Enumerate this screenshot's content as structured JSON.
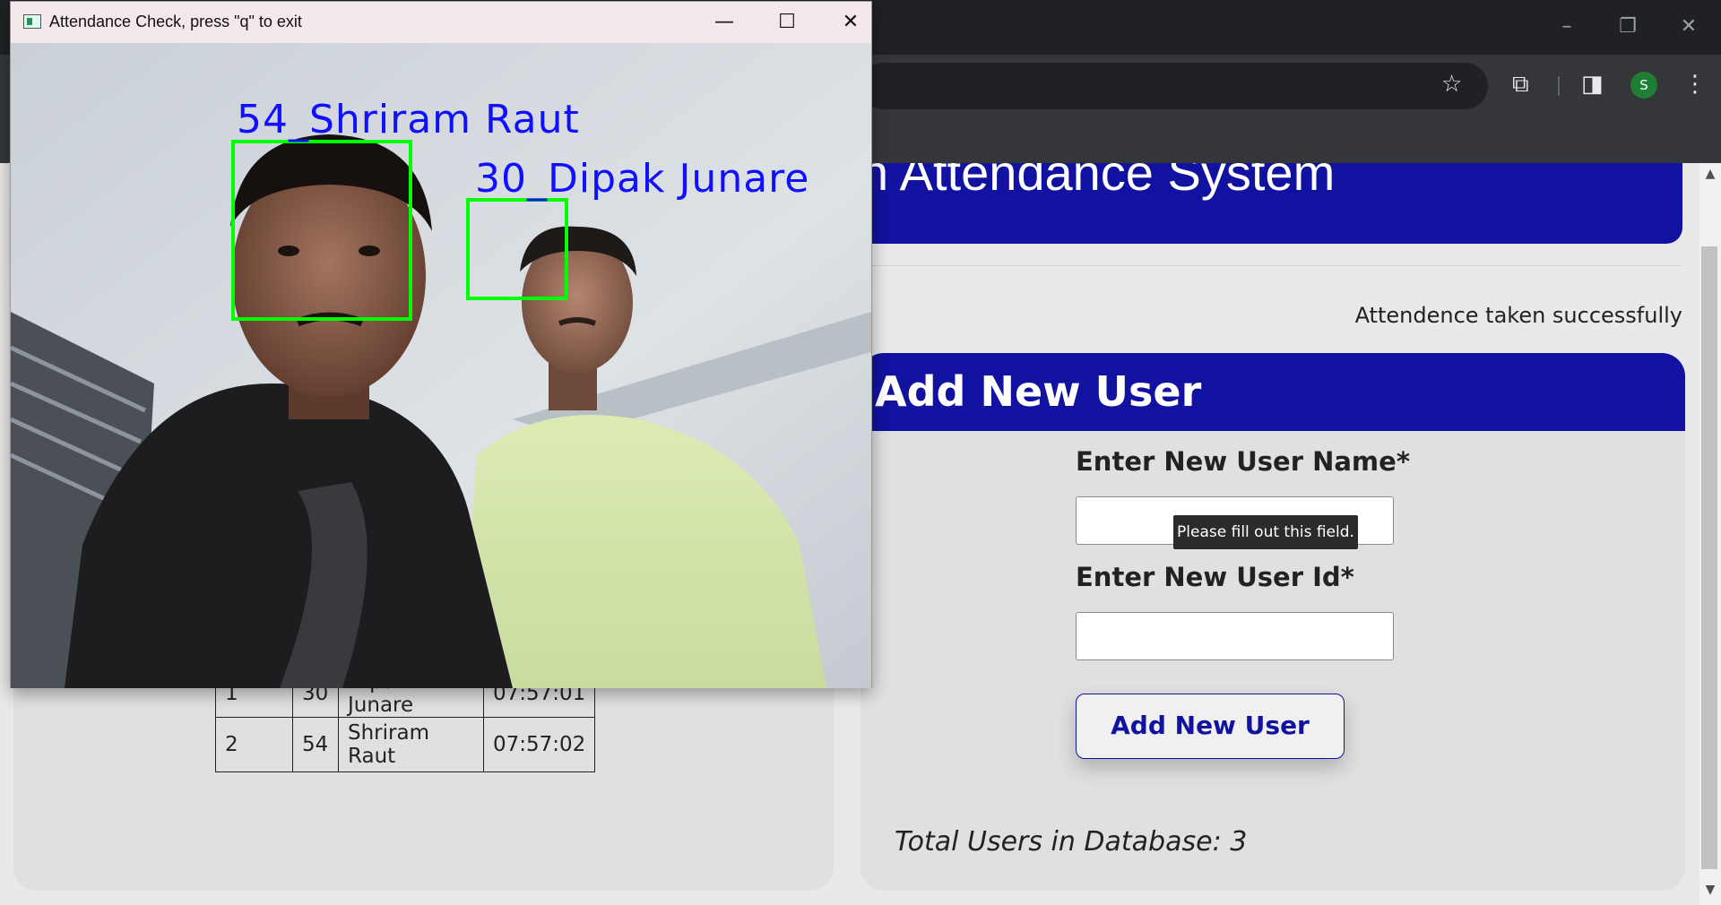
{
  "browser": {
    "minimize_glyph": "–",
    "restore_glyph": "❐",
    "close_glyph": "✕",
    "bookmark_glyph": "☆",
    "extensions_glyph": "⧉",
    "sidepanel_glyph": "◨",
    "profile_initial": "S",
    "menu_glyph": "⋮"
  },
  "page": {
    "title_visible_fragment": "n Attendance System",
    "success_message": "Attendence taken successfully",
    "attendance_table": {
      "rows": [
        {
          "sno": "1",
          "id": "30",
          "name": "Dipak Junare",
          "time": "07:57:01"
        },
        {
          "sno": "2",
          "id": "54",
          "name": "Shriram Raut",
          "time": "07:57:02"
        }
      ]
    },
    "add_user": {
      "header": "Add New User",
      "name_label": "Enter New User Name*",
      "name_value": "",
      "id_label": "Enter New User Id*",
      "id_value": "",
      "tooltip": "Please fill out this field.",
      "button_label": "Add New User",
      "total_users": "Total Users in Database: 3"
    }
  },
  "cv_window": {
    "title": "Attendance Check, press \"q\" to exit",
    "minimize_glyph": "—",
    "maximize_glyph": "☐",
    "close_glyph": "✕",
    "faces": [
      {
        "label": "54_Shriram Raut"
      },
      {
        "label": "30_Dipak Junare"
      }
    ],
    "colors": {
      "box": "#00ff00",
      "label": "#1010ff"
    }
  }
}
